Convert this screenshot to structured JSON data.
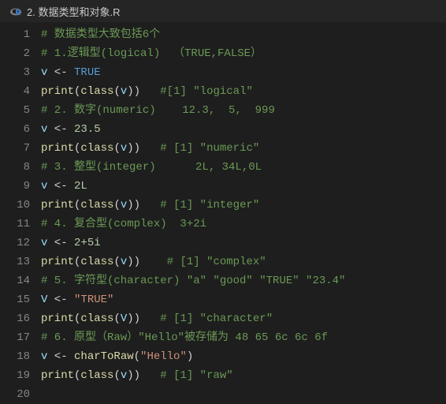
{
  "tab": {
    "title": "2. 数据类型和对象.R"
  },
  "lines": [
    {
      "num": "1",
      "tokens": [
        {
          "cls": "c-comment",
          "t": "# 数据类型大致包括6个"
        }
      ]
    },
    {
      "num": "2",
      "tokens": [
        {
          "cls": "c-comment",
          "t": "# 1.逻辑型(logical)  （TRUE,FALSE）"
        }
      ]
    },
    {
      "num": "3",
      "tokens": [
        {
          "cls": "c-var",
          "t": "v"
        },
        {
          "cls": "c-op",
          "t": " <- "
        },
        {
          "cls": "c-const",
          "t": "TRUE"
        }
      ]
    },
    {
      "num": "4",
      "tokens": [
        {
          "cls": "c-func",
          "t": "print"
        },
        {
          "cls": "c-paren",
          "t": "("
        },
        {
          "cls": "c-func",
          "t": "class"
        },
        {
          "cls": "c-paren",
          "t": "("
        },
        {
          "cls": "c-var",
          "t": "v"
        },
        {
          "cls": "c-paren",
          "t": ")"
        },
        {
          "cls": "c-paren",
          "t": ")   "
        },
        {
          "cls": "c-comment",
          "t": "#[1] \"logical\""
        }
      ]
    },
    {
      "num": "5",
      "tokens": [
        {
          "cls": "c-comment",
          "t": "# 2. 数字(numeric)    12.3,  5,  999"
        }
      ]
    },
    {
      "num": "6",
      "tokens": [
        {
          "cls": "c-var",
          "t": "v"
        },
        {
          "cls": "c-op",
          "t": " <- "
        },
        {
          "cls": "c-num",
          "t": "23.5"
        }
      ]
    },
    {
      "num": "7",
      "tokens": [
        {
          "cls": "c-func",
          "t": "print"
        },
        {
          "cls": "c-paren",
          "t": "("
        },
        {
          "cls": "c-func",
          "t": "class"
        },
        {
          "cls": "c-paren",
          "t": "("
        },
        {
          "cls": "c-var",
          "t": "v"
        },
        {
          "cls": "c-paren",
          "t": ")"
        },
        {
          "cls": "c-paren",
          "t": ")   "
        },
        {
          "cls": "c-comment",
          "t": "# [1] \"numeric\""
        }
      ]
    },
    {
      "num": "8",
      "tokens": [
        {
          "cls": "c-comment",
          "t": "# 3. 整型(integer)      2L, 34L,0L"
        }
      ]
    },
    {
      "num": "9",
      "tokens": [
        {
          "cls": "c-var",
          "t": "v"
        },
        {
          "cls": "c-op",
          "t": " <- "
        },
        {
          "cls": "c-num",
          "t": "2L"
        }
      ]
    },
    {
      "num": "10",
      "tokens": [
        {
          "cls": "c-func",
          "t": "print"
        },
        {
          "cls": "c-paren",
          "t": "("
        },
        {
          "cls": "c-func",
          "t": "class"
        },
        {
          "cls": "c-paren",
          "t": "("
        },
        {
          "cls": "c-var",
          "t": "v"
        },
        {
          "cls": "c-paren",
          "t": ")"
        },
        {
          "cls": "c-paren",
          "t": ")   "
        },
        {
          "cls": "c-comment",
          "t": "# [1] \"integer\""
        }
      ]
    },
    {
      "num": "11",
      "tokens": [
        {
          "cls": "c-comment",
          "t": "# 4. 复合型(complex)  3+2i"
        }
      ]
    },
    {
      "num": "12",
      "tokens": [
        {
          "cls": "c-var",
          "t": "v"
        },
        {
          "cls": "c-op",
          "t": " <- "
        },
        {
          "cls": "c-num",
          "t": "2+5i"
        }
      ]
    },
    {
      "num": "13",
      "tokens": [
        {
          "cls": "c-func",
          "t": "print"
        },
        {
          "cls": "c-paren",
          "t": "("
        },
        {
          "cls": "c-func",
          "t": "class"
        },
        {
          "cls": "c-paren",
          "t": "("
        },
        {
          "cls": "c-var",
          "t": "v"
        },
        {
          "cls": "c-paren",
          "t": ")"
        },
        {
          "cls": "c-paren",
          "t": ")    "
        },
        {
          "cls": "c-comment",
          "t": "# [1] \"complex\""
        }
      ]
    },
    {
      "num": "14",
      "tokens": [
        {
          "cls": "c-comment",
          "t": "# 5. 字符型(character) \"a\" \"good\" \"TRUE\" \"23.4\""
        }
      ]
    },
    {
      "num": "15",
      "tokens": [
        {
          "cls": "c-var",
          "t": "V"
        },
        {
          "cls": "c-op",
          "t": " <- "
        },
        {
          "cls": "c-str",
          "t": "\"TRUE\""
        }
      ]
    },
    {
      "num": "16",
      "tokens": [
        {
          "cls": "c-func",
          "t": "print"
        },
        {
          "cls": "c-paren",
          "t": "("
        },
        {
          "cls": "c-func",
          "t": "class"
        },
        {
          "cls": "c-paren",
          "t": "("
        },
        {
          "cls": "c-var",
          "t": "V"
        },
        {
          "cls": "c-paren",
          "t": ")"
        },
        {
          "cls": "c-paren",
          "t": ")   "
        },
        {
          "cls": "c-comment",
          "t": "# [1] \"character\""
        }
      ]
    },
    {
      "num": "17",
      "tokens": [
        {
          "cls": "c-comment",
          "t": "# 6. 原型（Raw）\"Hello\"被存储为 48 65 6c 6c 6f"
        }
      ]
    },
    {
      "num": "18",
      "tokens": [
        {
          "cls": "c-var",
          "t": "v"
        },
        {
          "cls": "c-op",
          "t": " <- "
        },
        {
          "cls": "c-func",
          "t": "charToRaw"
        },
        {
          "cls": "c-paren",
          "t": "("
        },
        {
          "cls": "c-str",
          "t": "\"Hello\""
        },
        {
          "cls": "c-paren",
          "t": ")"
        }
      ]
    },
    {
      "num": "19",
      "tokens": [
        {
          "cls": "c-func",
          "t": "print"
        },
        {
          "cls": "c-paren",
          "t": "("
        },
        {
          "cls": "c-func",
          "t": "class"
        },
        {
          "cls": "c-paren",
          "t": "("
        },
        {
          "cls": "c-var",
          "t": "v"
        },
        {
          "cls": "c-paren",
          "t": ")"
        },
        {
          "cls": "c-paren",
          "t": ")   "
        },
        {
          "cls": "c-comment",
          "t": "# [1] \"raw\""
        }
      ]
    },
    {
      "num": "20",
      "tokens": []
    }
  ]
}
